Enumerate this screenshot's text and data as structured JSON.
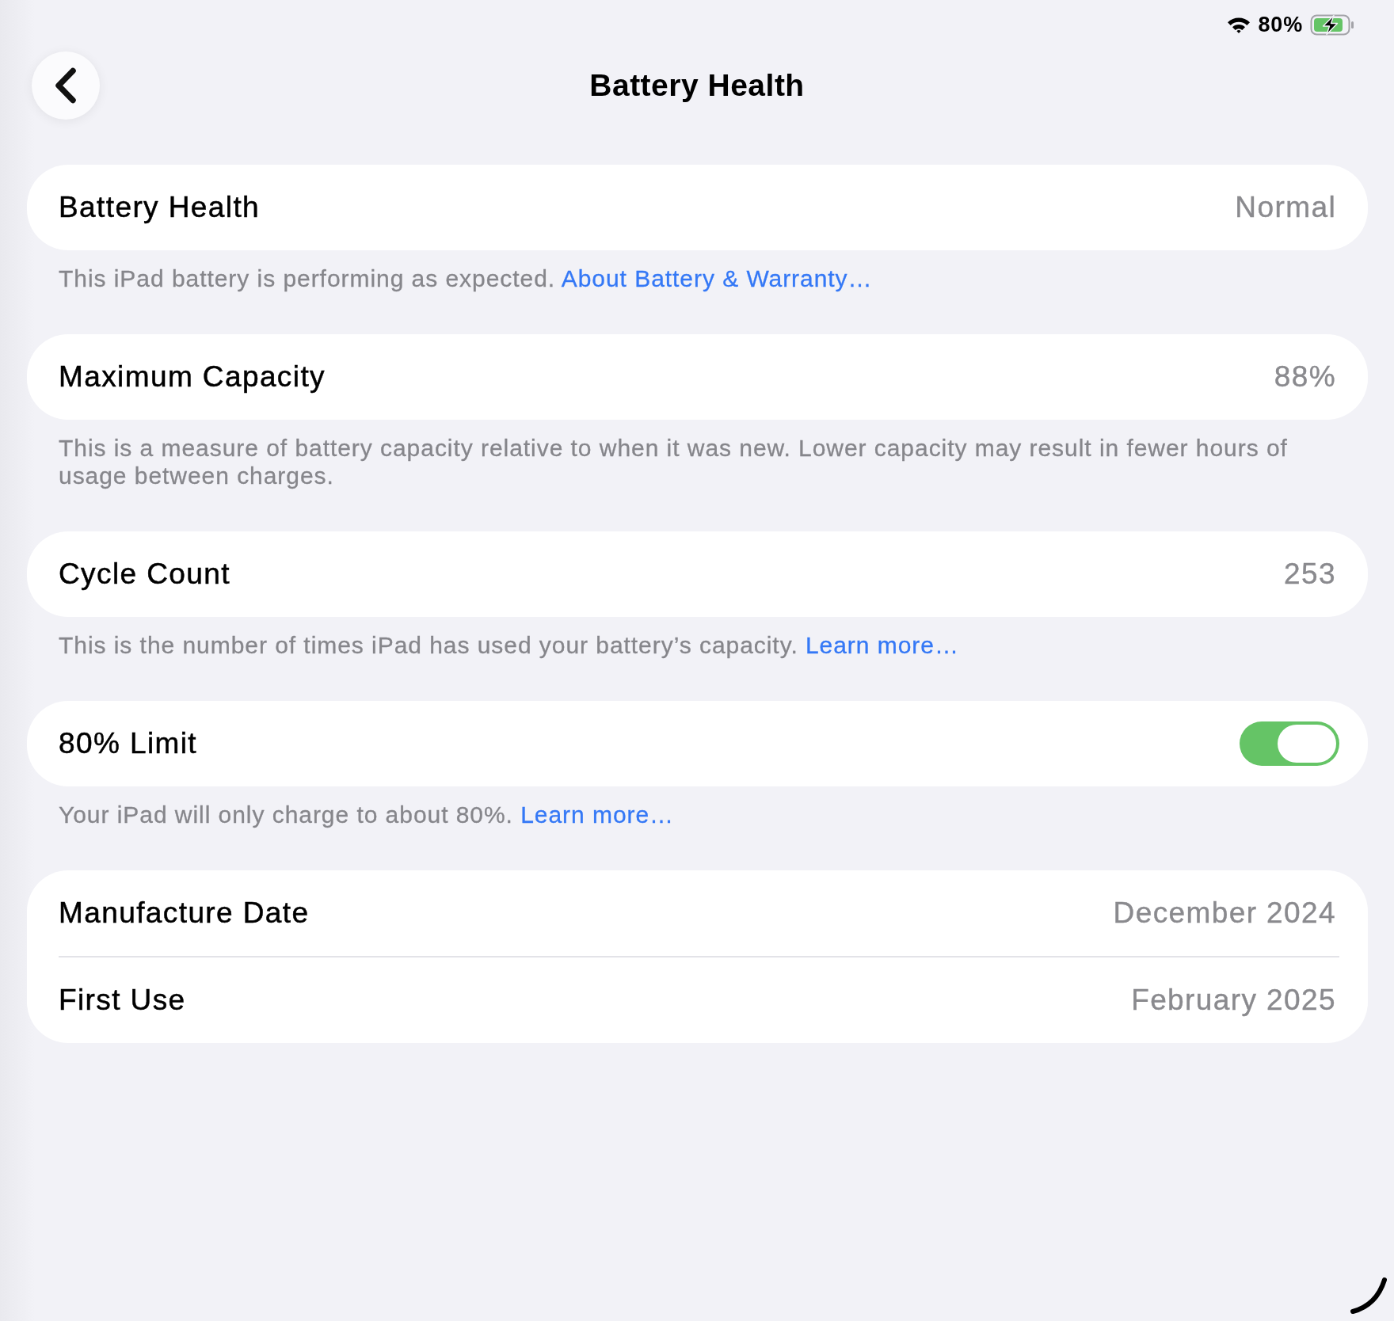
{
  "status_bar": {
    "battery_percent": "80%",
    "charging": true
  },
  "navigation": {
    "title": "Battery Health"
  },
  "sections": [
    {
      "rows": [
        {
          "kind": "value",
          "label": "Battery Health",
          "value": "Normal"
        }
      ],
      "footer": {
        "text": "This iPad battery is performing as expected.",
        "link": "About Battery & Warranty…"
      }
    },
    {
      "rows": [
        {
          "kind": "value",
          "label": "Maximum Capacity",
          "value": "88%"
        }
      ],
      "footer": {
        "text": "This is a measure of battery capacity relative to when it was new. Lower capacity may result in fewer hours of usage between charges."
      }
    },
    {
      "rows": [
        {
          "kind": "value",
          "label": "Cycle Count",
          "value": "253"
        }
      ],
      "footer": {
        "text": "This is the number of times iPad has used your battery’s capacity.",
        "link": "Learn more…"
      }
    },
    {
      "rows": [
        {
          "kind": "toggle",
          "label": "80% Limit",
          "on": true
        }
      ],
      "footer": {
        "text": "Your iPad will only charge to about 80%.",
        "link": "Learn more…"
      }
    },
    {
      "rows": [
        {
          "kind": "value",
          "label": "Manufacture Date",
          "value": "December 2024"
        },
        {
          "kind": "value",
          "label": "First Use",
          "value": "February 2025"
        }
      ]
    }
  ]
}
